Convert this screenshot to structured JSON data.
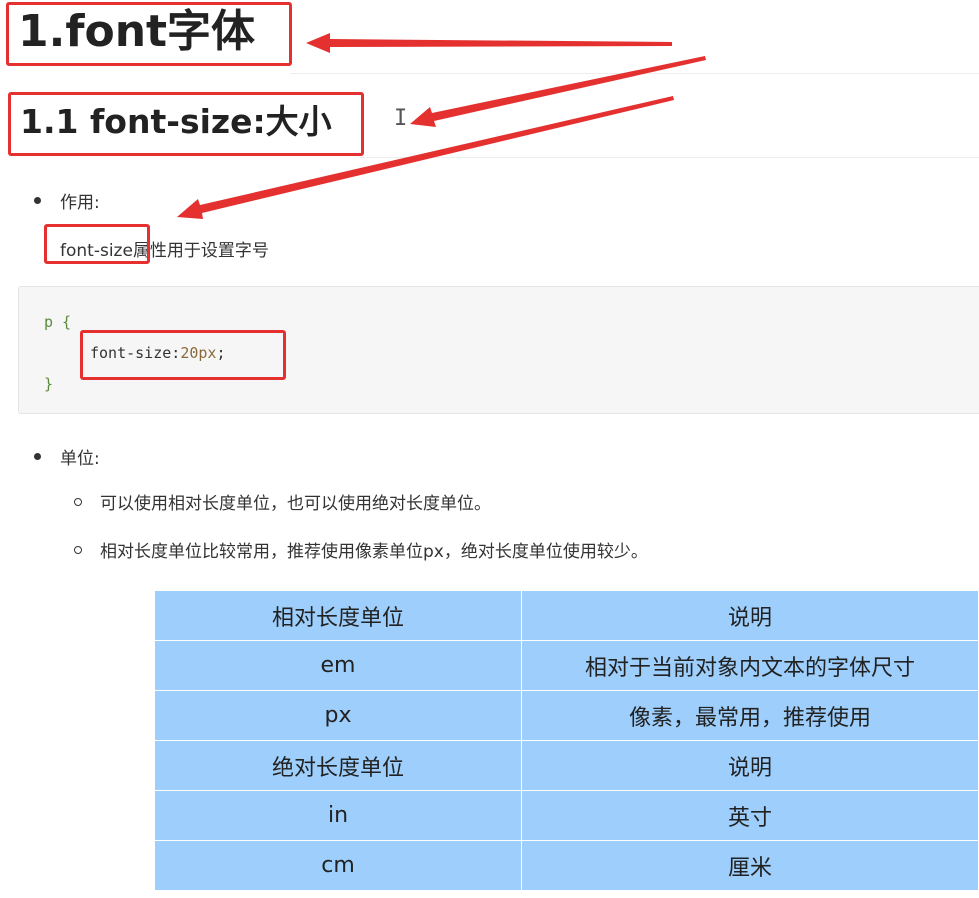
{
  "heading1": "1.font字体",
  "heading2": "1.1 font-size:大小",
  "section_effect": {
    "label": "作用:",
    "prop_name": "font-size",
    "description": "属性用于设置字号"
  },
  "code": {
    "selector": "p {",
    "prop": "font-size",
    "colon": ":",
    "value": "20px",
    "semicolon": ";",
    "close": "}"
  },
  "section_units": {
    "label": "单位:",
    "items": [
      "可以使用相对长度单位，也可以使用绝对长度单位。",
      "相对长度单位比较常用，推荐使用像素单位px，绝对长度单位使用较少。"
    ]
  },
  "table": {
    "rows": [
      [
        "相对长度单位",
        "说明"
      ],
      [
        "em",
        "相对于当前对象内文本的字体尺寸"
      ],
      [
        "px",
        "像素，最常用，推荐使用"
      ],
      [
        "绝对长度单位",
        "说明"
      ],
      [
        "in",
        "英寸"
      ],
      [
        "cm",
        "厘米"
      ]
    ]
  },
  "colors": {
    "annotation": "#e53030",
    "table_bg": "#9dcefc",
    "code_bg": "#f6f6f6",
    "code_selector": "#5a8a3a",
    "code_prop": "#333333",
    "code_value": "#8a6a3a"
  }
}
